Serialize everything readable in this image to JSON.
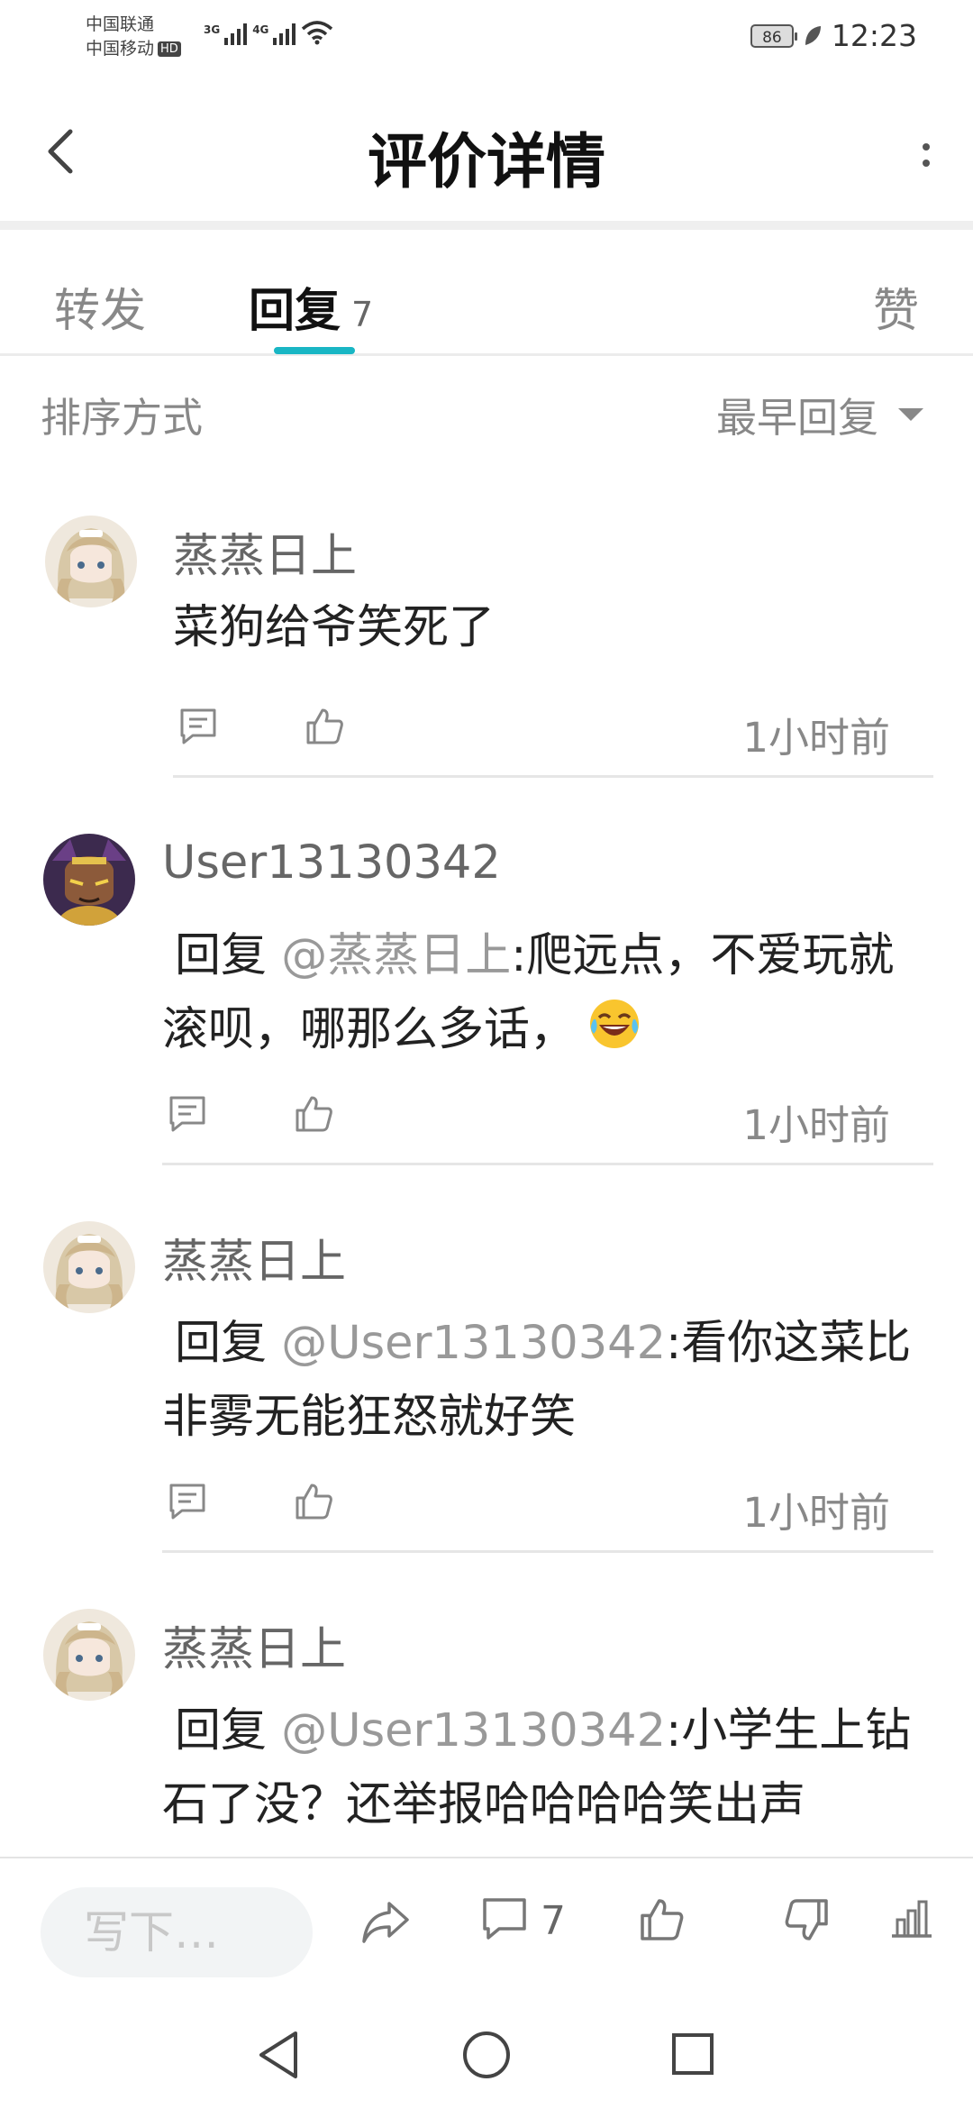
{
  "status_bar": {
    "carrier1": "中国联通",
    "carrier2": "中国移动",
    "hd_badge": "HD",
    "net1": "3G",
    "net2": "4G",
    "battery": "86",
    "time": "12:23"
  },
  "header": {
    "title": "评价详情",
    "back_icon": "chevron-left-icon",
    "menu_icon": "more-vertical-icon"
  },
  "tabs": {
    "forward": "转发",
    "reply": "回复",
    "reply_count": "7",
    "like": "赞"
  },
  "sort": {
    "label": "排序方式",
    "selected": "最早回复"
  },
  "comments": [
    {
      "user": "蒸蒸日上",
      "text": "菜狗给爷笑死了",
      "time": "1小时前"
    },
    {
      "user": "User13130342",
      "reply_word": "回复",
      "mention": "@蒸蒸日上",
      "text": ":爬远点，不爱玩就滚呗，哪那么多话，",
      "emoji": "laughing-tears-emoji",
      "time": "1小时前"
    },
    {
      "user": "蒸蒸日上",
      "reply_word": "回复",
      "mention": "@User13130342",
      "text": ":看你这菜比非雾无能狂怒就好笑",
      "time": "1小时前"
    },
    {
      "user": "蒸蒸日上",
      "reply_word": "回复",
      "mention": "@User13130342",
      "text": ":小学生上钻石了没？还举报哈哈哈哈笑出声"
    }
  ],
  "bottom_bar": {
    "input_placeholder": "写下…",
    "comment_count": "7"
  },
  "colors": {
    "accent": "#19b6c4",
    "mention": "#999999"
  }
}
